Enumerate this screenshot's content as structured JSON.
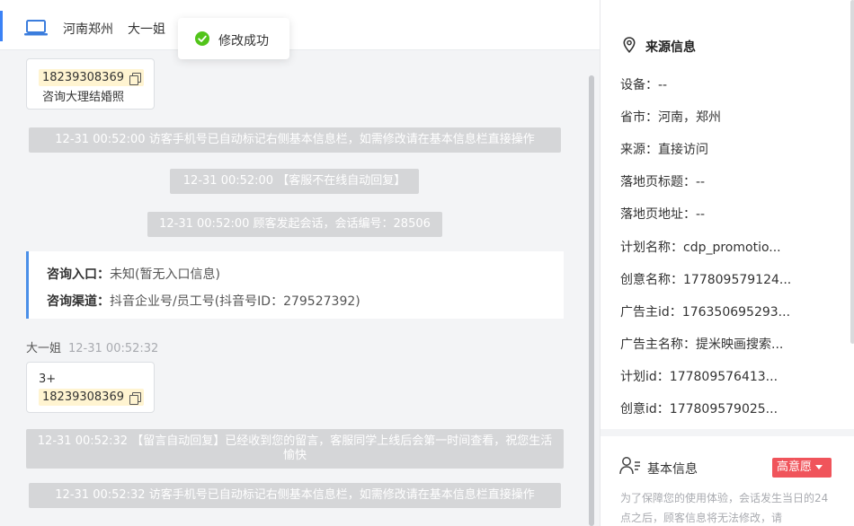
{
  "header": {
    "location": "河南郑州",
    "visitor_name": "大一姐"
  },
  "toast": {
    "message": "修改成功"
  },
  "chat": {
    "top_bubble": {
      "phone": "18239308369",
      "text": "咨询大理结婚照"
    },
    "system_messages": [
      "12-31 00:52:00 访客手机号已自动标记右侧基本信息栏，如需修改请在基本信息栏直接操作",
      "12-31 00:52:00 【客服不在线自动回复】",
      "12-31 00:52:00 顾客发起会话，会话编号：28506"
    ],
    "entry": {
      "entry_label": "咨询入口：",
      "entry_value": "未知(暂无入口信息)",
      "channel_label": "咨询渠道：",
      "channel_value": "抖音企业号/员工号(抖音号ID：279527392)"
    },
    "message_meta": {
      "sender": "大一姐",
      "time": "12-31 00:52:32"
    },
    "second_bubble": {
      "line1": "3+",
      "phone": "18239308369"
    },
    "system_messages_2": [
      "12-31 00:52:32 【留言自动回复】已经收到您的留言，客服同学上线后会第一时间查看，祝您生活愉快",
      "12-31 00:52:32 访客手机号已自动标记右侧基本信息栏，如需修改请在基本信息栏直接操作"
    ]
  },
  "source_info": {
    "title": "来源信息",
    "fields": [
      {
        "label": "设备：",
        "value": "--"
      },
      {
        "label": "省市：",
        "value": "河南，郑州"
      },
      {
        "label": "来源：",
        "value": "直接访问"
      },
      {
        "label": "落地页标题：",
        "value": "--"
      },
      {
        "label": "落地页地址：",
        "value": "--"
      },
      {
        "label": "计划名称：",
        "value": "cdp_promotio..."
      },
      {
        "label": "创意名称：",
        "value": "177809579124..."
      },
      {
        "label": "广告主id：",
        "value": "176350695293..."
      },
      {
        "label": "广告主名称：",
        "value": "提米映画搜索..."
      },
      {
        "label": "计划id：",
        "value": "177809576413..."
      },
      {
        "label": "创意id：",
        "value": "177809579025..."
      }
    ]
  },
  "basic_info": {
    "title": "基本信息",
    "intent_badge": "高意愿",
    "notice": "为了保障您的使用体验，会话发生当日的24点之后，顾客信息将无法修改，请"
  },
  "colors": {
    "accent_blue": "#4a8fe8",
    "success_green": "#52c41a",
    "badge_red": "#f0545b",
    "phone_highlight": "#fff4d1",
    "system_msg_bg": "#d5d6d8"
  }
}
